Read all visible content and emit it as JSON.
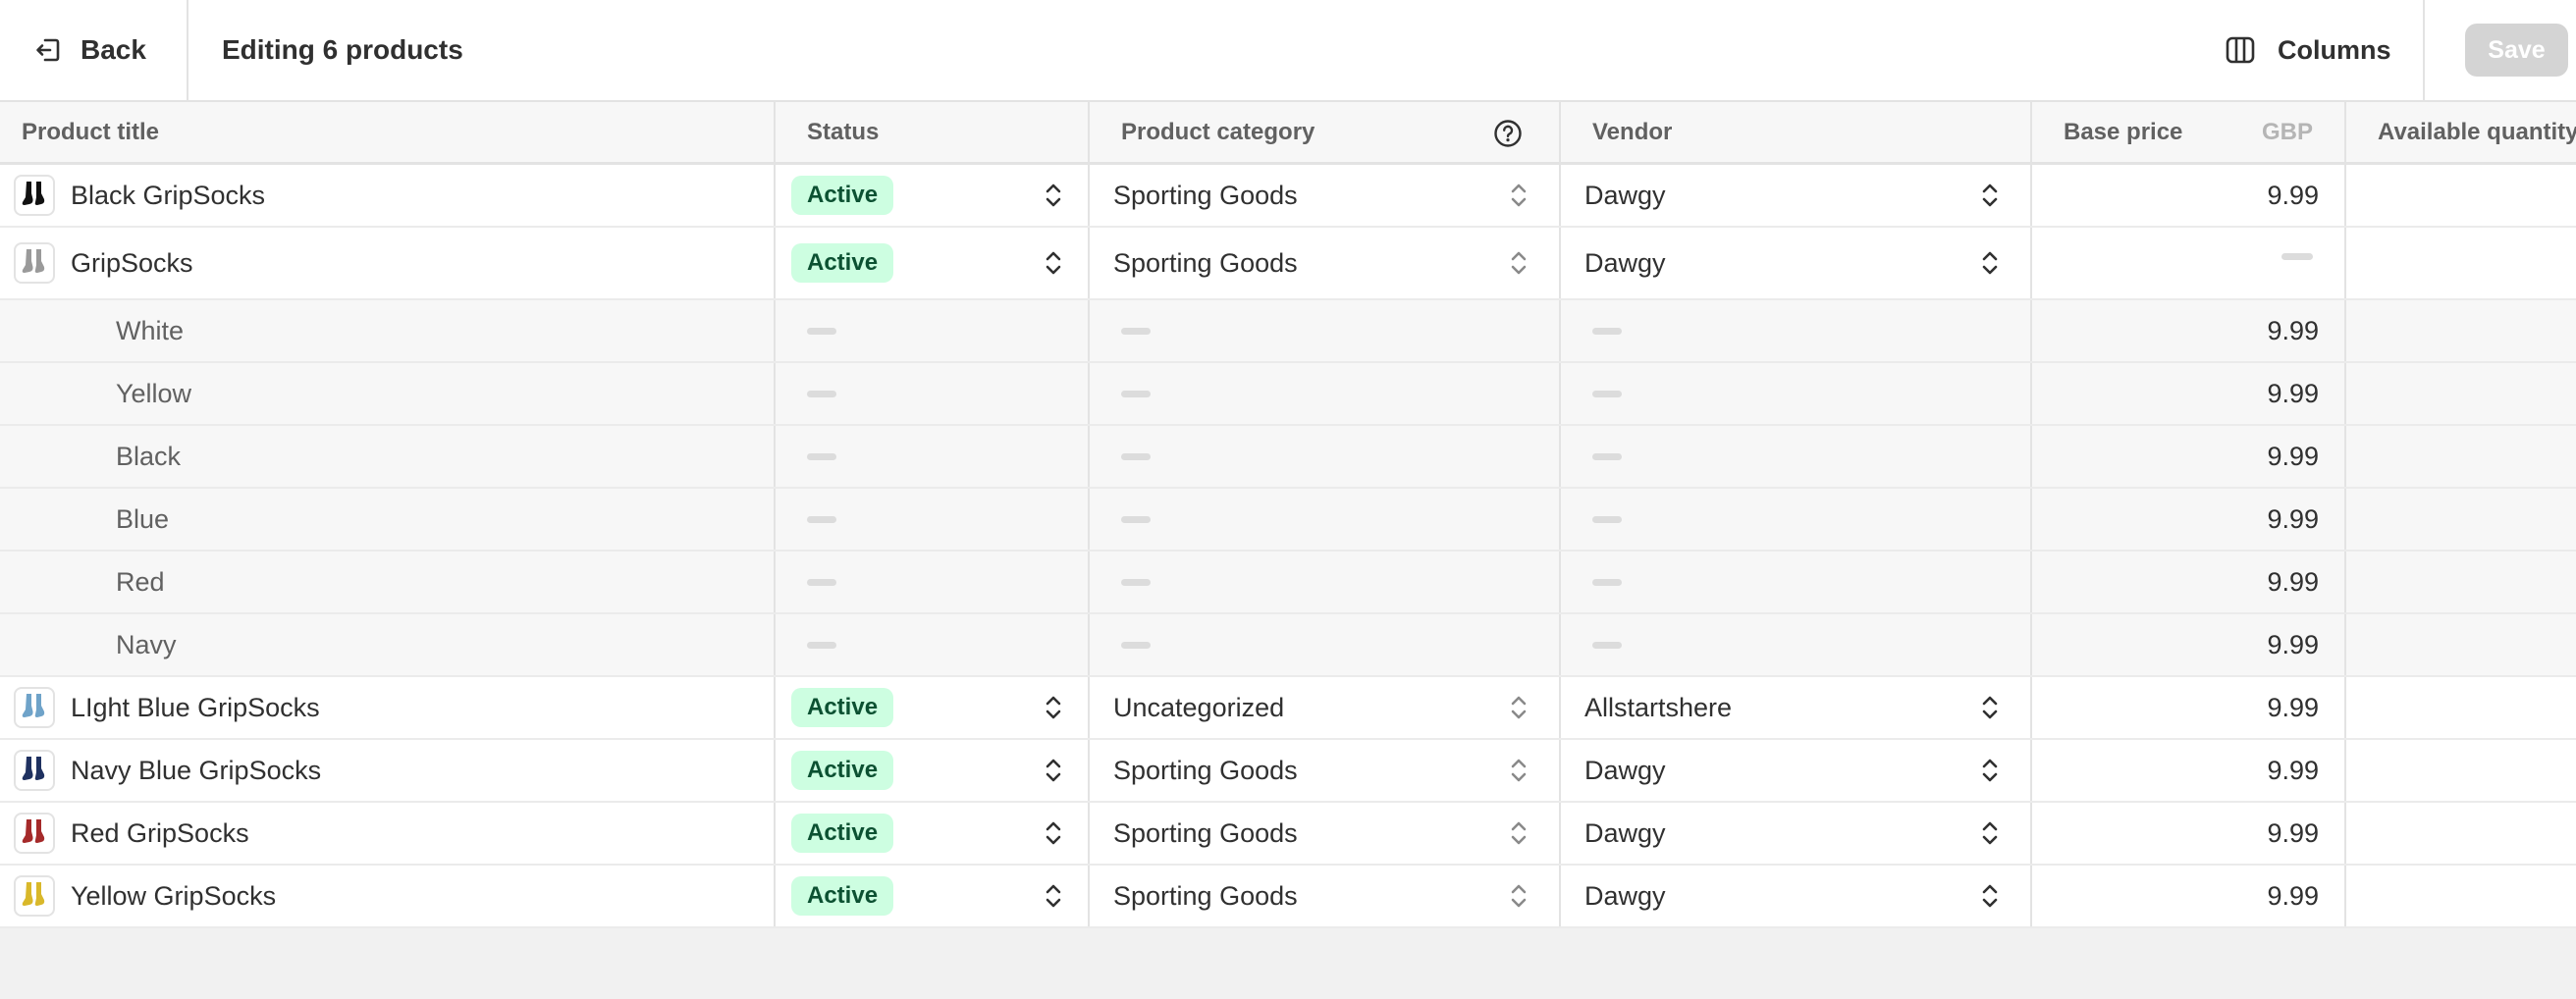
{
  "topbar": {
    "back_label": "Back",
    "title": "Editing 6 products",
    "columns_label": "Columns",
    "save_label": "Save"
  },
  "headers": {
    "title": "Product title",
    "status": "Status",
    "category": "Product category",
    "vendor": "Vendor",
    "price": "Base price",
    "currency": "GBP",
    "quantity": "Available quantity"
  },
  "rows": [
    {
      "title": "Black GripSocks",
      "status": "Active",
      "category": "Sporting Goods",
      "vendor": "Dawgy",
      "price": "9.99",
      "thumb_color": "#111111"
    },
    {
      "title": "GripSocks",
      "status": "Active",
      "category": "Sporting Goods",
      "vendor": "Dawgy",
      "price": "",
      "thumb_color": "#9a9a9a"
    },
    {
      "title": "White"
    },
    {
      "title": "Yellow"
    },
    {
      "title": "Black"
    },
    {
      "title": "Blue"
    },
    {
      "title": "Red"
    },
    {
      "title": "Navy"
    },
    {
      "title": "LIght Blue GripSocks",
      "status": "Active",
      "category": "Uncategorized",
      "vendor": "Allstartshere",
      "price": "9.99",
      "thumb_color": "#6fa3c9"
    },
    {
      "title": "Navy Blue GripSocks",
      "status": "Active",
      "category": "Sporting Goods",
      "vendor": "Dawgy",
      "price": "9.99",
      "thumb_color": "#1f3160"
    },
    {
      "title": "Red GripSocks",
      "status": "Active",
      "category": "Sporting Goods",
      "vendor": "Dawgy",
      "price": "9.99",
      "thumb_color": "#a52a2a"
    },
    {
      "title": "Yellow GripSocks",
      "status": "Active",
      "category": "Sporting Goods",
      "vendor": "Dawgy",
      "price": "9.99",
      "thumb_color": "#d9b82a"
    }
  ],
  "variant_price": "9.99"
}
